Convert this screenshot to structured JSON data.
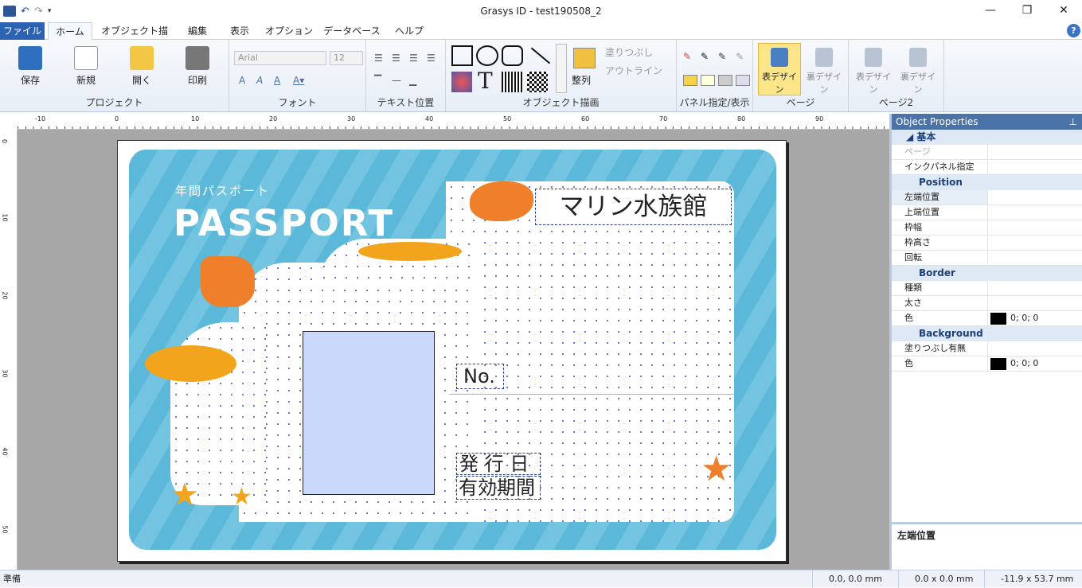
{
  "window": {
    "title": "Grasys ID - test190508_2"
  },
  "tabs": [
    {
      "label": "ファイル"
    },
    {
      "label": "ホーム"
    },
    {
      "label": "オブジェクト描画"
    },
    {
      "label": "編集"
    },
    {
      "label": "表示"
    },
    {
      "label": "オプション"
    },
    {
      "label": "データベース"
    },
    {
      "label": "ヘルプ"
    }
  ],
  "ribbon": {
    "project": {
      "label": "プロジェクト",
      "save": "保存",
      "new": "新規",
      "open": "開く",
      "print": "印刷"
    },
    "font": {
      "label": "フォント",
      "name_placeholder": "Arial",
      "size_placeholder": "12"
    },
    "text_pos": {
      "label": "テキスト位置"
    },
    "draw": {
      "label": "オブジェクト描画",
      "arrange": "整列",
      "fill": "塗りつぶし",
      "outline": "アウトライン"
    },
    "panel": {
      "label": "パネル指定/表示"
    },
    "page": {
      "label": "ページ",
      "front": "表デザイン",
      "back": "裏デザイン"
    },
    "page2": {
      "label": "ページ2",
      "front": "表デザイン",
      "back": "裏デザイン"
    }
  },
  "rulers": {
    "top": [
      "-10",
      "0",
      "10",
      "20",
      "30",
      "40",
      "50",
      "60",
      "70",
      "80",
      "90"
    ],
    "left": [
      "0",
      "10",
      "20",
      "30",
      "40",
      "50"
    ]
  },
  "card": {
    "passport_jp": "年間パスポート",
    "passport_en": "PASSPORT",
    "name": "マリン水族館",
    "no": "No.",
    "issue": "発 行 日",
    "valid": "有効期間"
  },
  "props": {
    "title": "Object Properties",
    "sections": [
      {
        "name": "基本",
        "rows": [
          {
            "k": "ページ",
            "v": ""
          },
          {
            "k": "インクパネル指定",
            "v": ""
          }
        ]
      },
      {
        "name": "Position",
        "rows": [
          {
            "k": "左端位置",
            "v": ""
          },
          {
            "k": "上端位置",
            "v": ""
          },
          {
            "k": "枠幅",
            "v": ""
          },
          {
            "k": "枠高さ",
            "v": ""
          },
          {
            "k": "回転",
            "v": ""
          }
        ]
      },
      {
        "name": "Border",
        "rows": [
          {
            "k": "種類",
            "v": ""
          },
          {
            "k": "太さ",
            "v": ""
          },
          {
            "k": "色",
            "v": "0; 0; 0"
          }
        ]
      },
      {
        "name": "Background",
        "rows": [
          {
            "k": "塗りつぶし有無",
            "v": ""
          },
          {
            "k": "色",
            "v": "0; 0; 0"
          }
        ]
      }
    ],
    "description": "左端位置"
  },
  "status": {
    "ready": "準備",
    "pos": "0.0, 0.0 mm",
    "size": "0.0 x 0.0 mm",
    "cursor": "-11.9 x 53.7 mm"
  }
}
